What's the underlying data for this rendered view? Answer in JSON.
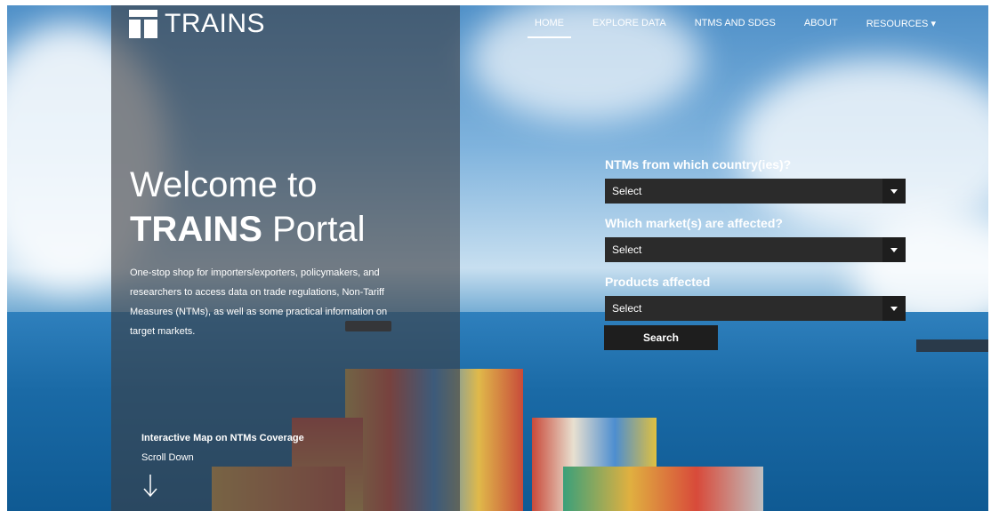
{
  "brand": {
    "name": "TRAINS"
  },
  "nav": [
    {
      "label": "HOME"
    },
    {
      "label": "EXPLORE DATA"
    },
    {
      "label": "NTMS AND SDGS"
    },
    {
      "label": "ABOUT"
    },
    {
      "label": "RESOURCES ▾"
    }
  ],
  "hero": {
    "line1": "Welcome to",
    "line2_bold": "TRAINS",
    "line2_rest": " Portal",
    "description": "One-stop shop for importers/exporters, policymakers, and researchers to access data on trade regulations, Non-Tariff Measures (NTMs), as well as some practical information on target markets.",
    "map_link": "Interactive Map on NTMs Coverage",
    "scroll": "Scroll Down"
  },
  "form": {
    "q1": "NTMs from which country(ies)?",
    "q2": "Which market(s) are affected?",
    "q3": "Products affected",
    "select_value": "Select",
    "search_label": "Search"
  },
  "colors": {
    "panel": "#3c3e42",
    "select_bg": "#2b2b2b",
    "button_bg": "#1e1e1e"
  }
}
